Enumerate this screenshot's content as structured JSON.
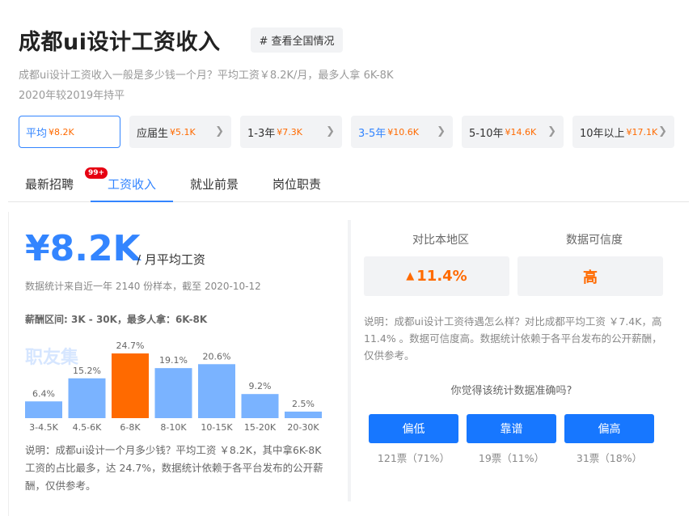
{
  "header": {
    "title": "成都ui设计工资收入",
    "tag_button": "# 查看全国情况",
    "subtitle": "成都ui设计工资收入一般是多少钱一个月？平均工资￥8.2K/月，最多人拿 6K-8K",
    "subtitle2": "2020年较2019年持平"
  },
  "exp_tabs": [
    {
      "label": "平均",
      "value": "¥8.2K",
      "active": true
    },
    {
      "label": "应届生",
      "value": "¥5.1K"
    },
    {
      "label": "1-3年",
      "value": "¥7.3K"
    },
    {
      "label": "3-5年",
      "value": "¥10.6K",
      "blue": true
    },
    {
      "label": "5-10年",
      "value": "¥14.6K"
    },
    {
      "label": "10年以上",
      "value": "¥17.1K"
    }
  ],
  "nav_tabs": [
    {
      "label": "最新招聘",
      "badge": "99+"
    },
    {
      "label": "工资收入",
      "active": true
    },
    {
      "label": "就业前景"
    },
    {
      "label": "岗位职责"
    }
  ],
  "summary": {
    "salary": "¥8.2K",
    "unit": "/ 月平均工资",
    "stat_note": "数据统计来自近一年 2140 份样本，截至 2020-10-12",
    "range_line": "薪酬区间: 3K - 30K，最多人拿：6K-8K",
    "watermark": "职友集"
  },
  "chart_data": {
    "type": "bar",
    "categories": [
      "3-4.5K",
      "4.5-6K",
      "6-8K",
      "8-10K",
      "10-15K",
      "15-20K",
      "20-30K"
    ],
    "values": [
      6.4,
      15.2,
      24.7,
      19.1,
      20.6,
      9.2,
      2.5
    ],
    "value_labels": [
      "6.4%",
      "15.2%",
      "24.7%",
      "19.1%",
      "20.6%",
      "9.2%",
      "2.5%"
    ],
    "highlight_index": 2,
    "ylim": [
      0,
      24.7
    ],
    "colors": {
      "normal": "#7ab3ff",
      "highlight": "#ff6a00"
    }
  },
  "chart_note": "说明：成都ui设计一个月多少钱？平均工资 ￥8.2K，其中拿6K-8K 工资的占比最多，达 24.7%，数据统计依赖于各平台发布的公开薪酬，仅供参考。",
  "compare": {
    "region_label": "对比本地区",
    "region_value": "11.4%",
    "trust_label": "数据可信度",
    "trust_value": "高",
    "note": "说明：成都ui设计工资待遇怎么样？对比成都平均工资 ￥7.4K，高 11.4% 。数据可信度高。数据统计依赖于各平台发布的公开薪酬，仅供参考。",
    "question": "你觉得该统计数据准确吗?",
    "votes": [
      {
        "label": "偏低",
        "count": "121票（71%）"
      },
      {
        "label": "靠谱",
        "count": "19票（11%）"
      },
      {
        "label": "偏高",
        "count": "31票（18%）"
      }
    ]
  }
}
